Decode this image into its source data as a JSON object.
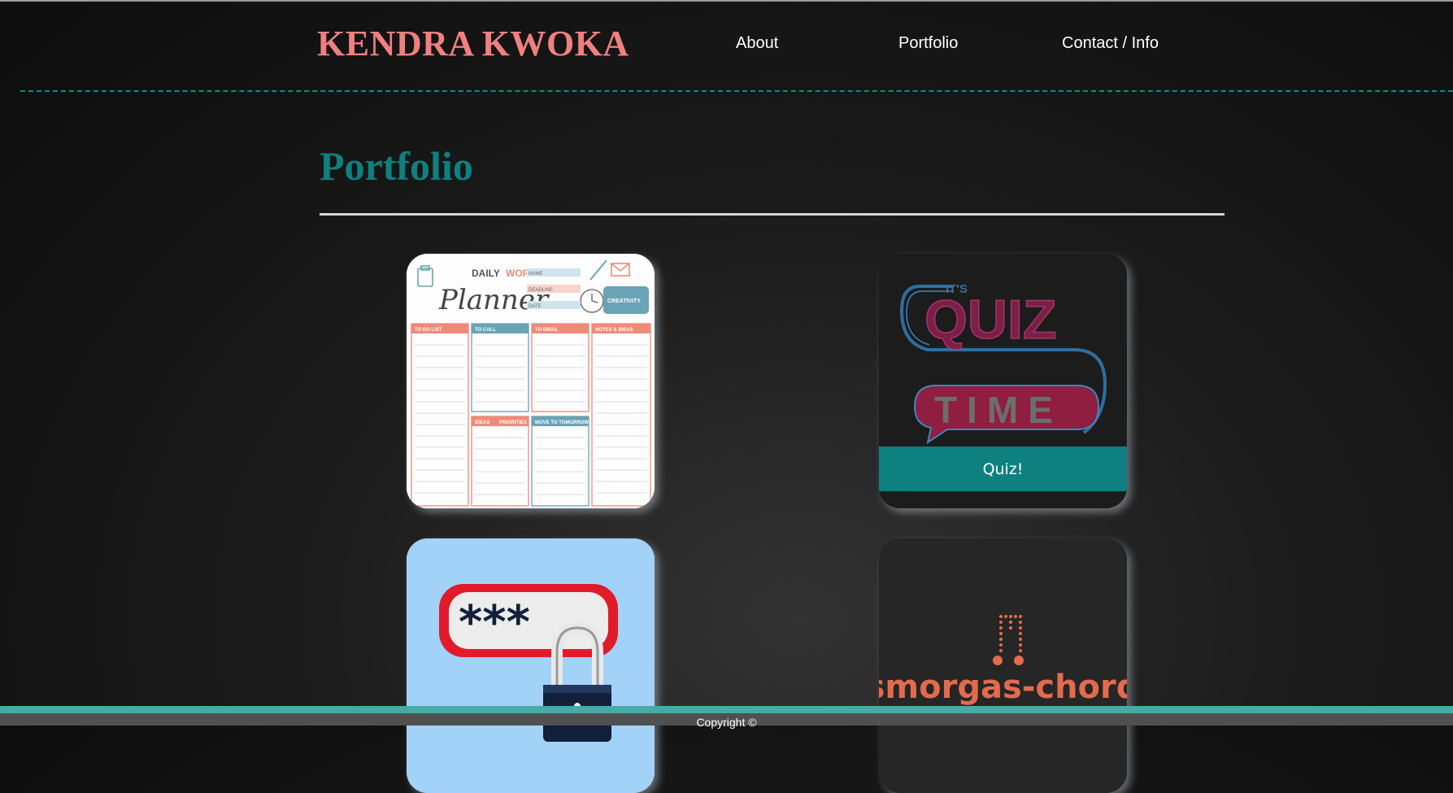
{
  "header": {
    "brand": "KENDRA KWOKA",
    "nav": [
      {
        "label": "About"
      },
      {
        "label": "Portfolio"
      },
      {
        "label": "Contact / Info"
      }
    ]
  },
  "main": {
    "title": "Portfolio",
    "projects": [
      {
        "image_text": {
          "script": "Planner",
          "top": "DAILY",
          "top_accent": "WORK",
          "badge": "CREATIVITY",
          "columns": [
            "TO DO LIST",
            "TO CALL",
            "TO EMAIL",
            "NOTES & IDEAS"
          ],
          "lower": [
            "IDEAS",
            "PRIORITIES",
            "MOVE TO TOMORROW"
          ],
          "fields": [
            "NAME",
            "DEADLINE",
            "DATE"
          ]
        }
      },
      {
        "image_text": {
          "small": "IT'S",
          "line1": "QUIZ",
          "line2": "TIME"
        },
        "button_label": "Quiz!"
      },
      {
        "image_text": {
          "mask": "***"
        }
      },
      {
        "image_text": {
          "wordmark": "smorgas-chord"
        }
      }
    ]
  },
  "footer": {
    "copyright": "Copyright ©"
  },
  "colors": {
    "brand": "#f08080",
    "accent": "#0f8080",
    "dash": "#0f8a8a",
    "footer_bar": "#47aaa6"
  },
  "icons": [
    "clipboard-icon",
    "clock-icon",
    "envelope-icon",
    "pencil-icon",
    "padlock-icon",
    "music-note-icon"
  ]
}
